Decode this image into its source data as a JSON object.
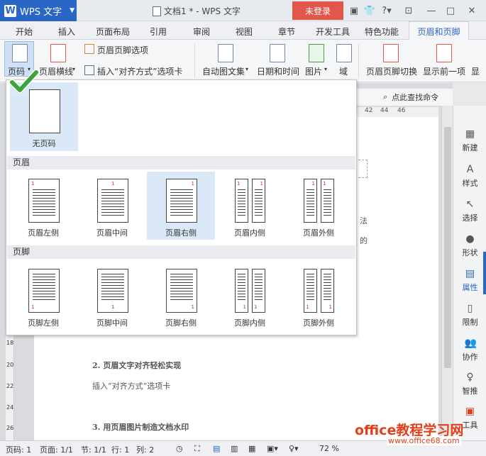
{
  "titlebar": {
    "app_name": "WPS 文字",
    "doc_title": "文档1 * - WPS 文字",
    "login": "未登录",
    "help": "?"
  },
  "tabs": [
    "开始",
    "插入",
    "页面布局",
    "引用",
    "审阅",
    "视图",
    "章节",
    "开发工具",
    "特色功能",
    "页眉和页脚"
  ],
  "ribbon": {
    "page_num": "页码",
    "header_line": "页眉横线",
    "header_footer_options": "页眉页脚选项",
    "insert_align_tab": "插入“对齐方式”选项卡",
    "auto_text": "自动图文集",
    "date_time": "日期和时间",
    "picture": "图片",
    "field": "域",
    "switch": "页眉页脚切换",
    "show_prev": "显示前一项",
    "show_next": "显"
  },
  "search": {
    "label": "点此查找命令"
  },
  "ruler": {
    "ticks": [
      "42",
      "44",
      "46"
    ]
  },
  "vruler": {
    "ticks": [
      "18",
      "20",
      "22",
      "24",
      "26"
    ]
  },
  "dropdown": {
    "no_page": "无页码",
    "header_section": "页眉",
    "footer_section": "页脚",
    "header_items": [
      "页眉左侧",
      "页眉中间",
      "页眉右侧",
      "页眉内侧",
      "页眉外侧"
    ],
    "footer_items": [
      "页脚左侧",
      "页脚中间",
      "页脚右侧",
      "页脚内侧",
      "页脚外侧"
    ],
    "num": "1"
  },
  "document": {
    "frag1": "法",
    "frag2": "的",
    "line1": "2. 页眉文字对齐轻松实现",
    "line2": "插入“对齐方式”选项卡",
    "line3": "3. 用页眉图片制造文档水印"
  },
  "rpanel": [
    "新建",
    "样式",
    "选择",
    "形状",
    "属性",
    "限制",
    "协作",
    "智推",
    "工具"
  ],
  "status": {
    "page": "页码: 1",
    "pages": "页面: 1/1",
    "section": "节: 1/1",
    "row": "行: 1",
    "col": "列: 2",
    "zoom": "72 %"
  },
  "watermark": {
    "main": "office教程学习网",
    "url": "www.office68.com"
  },
  "colors": {
    "accent": "#2a66c6",
    "login": "#e2574c",
    "number": "#c0392b",
    "check": "#3aa63a"
  }
}
